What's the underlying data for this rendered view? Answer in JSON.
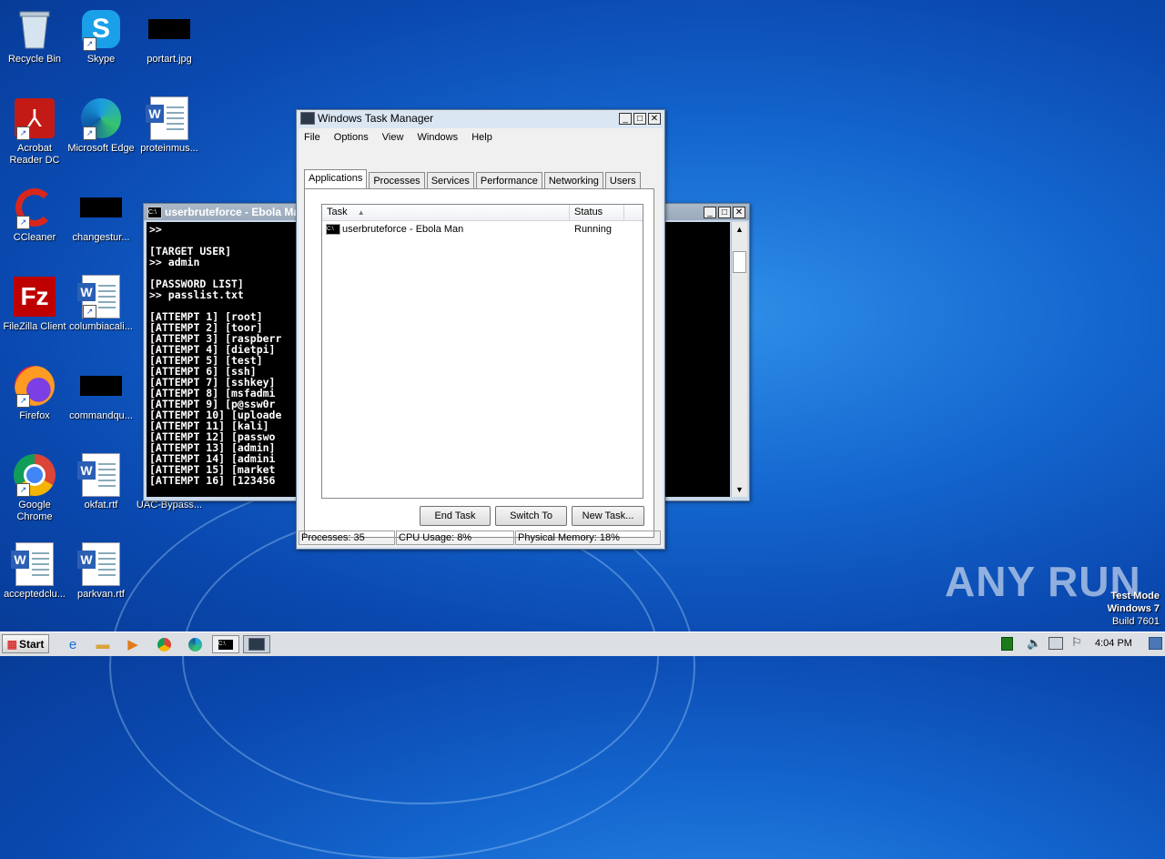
{
  "desktop": {
    "icons": [
      {
        "label": "Recycle Bin",
        "icon": "recycle-bin-icon"
      },
      {
        "label": "Skype",
        "icon": "skype-icon"
      },
      {
        "label": "portart.jpg",
        "icon": "image-file-icon"
      },
      {
        "label": "Acrobat Reader DC",
        "icon": "acrobat-icon"
      },
      {
        "label": "Microsoft Edge",
        "icon": "edge-icon"
      },
      {
        "label": "proteinmus...",
        "icon": "word-doc-icon"
      },
      {
        "label": "CCleaner",
        "icon": "ccleaner-icon"
      },
      {
        "label": "changestur...",
        "icon": "image-file-icon"
      },
      {
        "label": "FileZilla Client",
        "icon": "filezilla-icon"
      },
      {
        "label": "columbiacali...",
        "icon": "word-doc-icon"
      },
      {
        "label": "Firefox",
        "icon": "firefox-icon"
      },
      {
        "label": "commandqu...",
        "icon": "image-file-icon"
      },
      {
        "label": "Google Chrome",
        "icon": "chrome-icon"
      },
      {
        "label": "okfat.rtf",
        "icon": "word-doc-icon"
      },
      {
        "label": "UAC-Bypass...",
        "icon": "file-icon"
      },
      {
        "label": "acceptedclu...",
        "icon": "word-doc-icon"
      },
      {
        "label": "parkvan.rtf",
        "icon": "word-doc-icon"
      }
    ]
  },
  "console": {
    "title": "userbruteforce - Ebola Man",
    "lines": [
      ">>",
      "",
      "[TARGET USER]",
      ">> admin",
      "",
      "[PASSWORD LIST]",
      ">> passlist.txt",
      "",
      "[ATTEMPT 1] [root]",
      "[ATTEMPT 2] [toor]",
      "[ATTEMPT 3] [raspberr",
      "[ATTEMPT 4] [dietpi]",
      "[ATTEMPT 5] [test]",
      "[ATTEMPT 6] [ssh]",
      "[ATTEMPT 7] [sshkey]",
      "[ATTEMPT 8] [msfadmi",
      "[ATTEMPT 9] [p@ssw0r",
      "[ATTEMPT 10] [uploade",
      "[ATTEMPT 11] [kali]",
      "[ATTEMPT 12] [passwo",
      "[ATTEMPT 13] [admin]",
      "[ATTEMPT 14] [admini",
      "[ATTEMPT 15] [market",
      "[ATTEMPT 16] [123456"
    ]
  },
  "taskmgr": {
    "title": "Windows Task Manager",
    "menu": [
      "File",
      "Options",
      "View",
      "Windows",
      "Help"
    ],
    "tabs": [
      "Applications",
      "Processes",
      "Services",
      "Performance",
      "Networking",
      "Users"
    ],
    "columns": {
      "task": "Task",
      "status": "Status"
    },
    "rows": [
      {
        "task": "userbruteforce - Ebola Man",
        "status": "Running"
      }
    ],
    "buttons": {
      "end_task": "End Task",
      "switch_to": "Switch To",
      "new_task": "New Task..."
    },
    "statusbar": {
      "processes": "Processes: 35",
      "cpu": "CPU Usage: 8%",
      "memory": "Physical Memory: 18%"
    }
  },
  "watermark": {
    "text": "ANY RUN"
  },
  "os_info": {
    "line1": "Test Mode",
    "line2": "Windows 7",
    "line3": "Build 7601"
  },
  "taskbar": {
    "start_label": "Start",
    "clock": "4:04 PM"
  }
}
